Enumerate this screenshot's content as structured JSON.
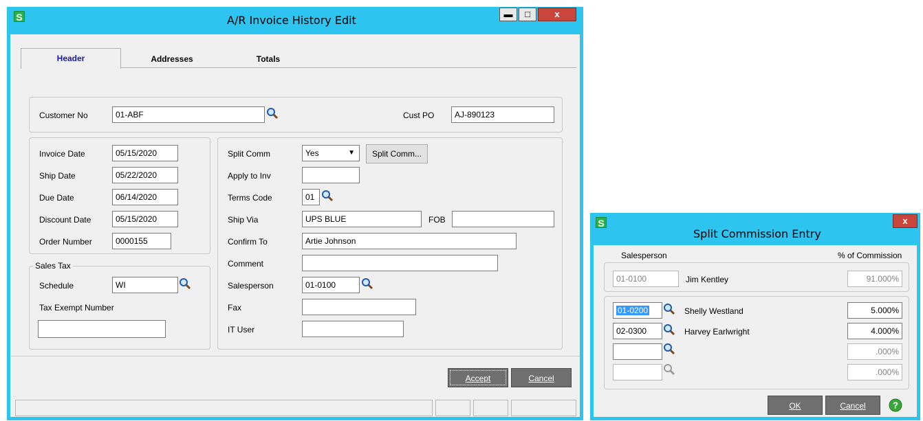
{
  "main_window": {
    "title": "A/R Invoice History Edit",
    "app_icon": "S",
    "controls": {
      "minimize": "minimize-icon",
      "maximize": "maximize-icon",
      "close": "close-icon"
    },
    "tabs": [
      {
        "label": "Header",
        "active": true
      },
      {
        "label": "Addresses",
        "active": false
      },
      {
        "label": "Totals",
        "active": false
      }
    ],
    "customer_no_label": "Customer No",
    "customer_no_value": "01-ABF",
    "cust_po_label": "Cust PO",
    "cust_po_value": "AJ-890123",
    "invoice_date_label": "Invoice Date",
    "invoice_date_value": "05/15/2020",
    "ship_date_label": "Ship Date",
    "ship_date_value": "05/22/2020",
    "due_date_label": "Due Date",
    "due_date_value": "06/14/2020",
    "discount_date_label": "Discount Date",
    "discount_date_value": "05/15/2020",
    "order_number_label": "Order Number",
    "order_number_value": "0000155",
    "sales_tax_group_label": "Sales Tax",
    "schedule_label": "Schedule",
    "schedule_value": "WI",
    "tax_exempt_label": "Tax Exempt Number",
    "tax_exempt_value": "",
    "split_comm_label": "Split Comm",
    "split_comm_value": "Yes",
    "split_comm_button": "Split Comm...",
    "apply_to_inv_label": "Apply to Inv",
    "apply_to_inv_value": "",
    "terms_code_label": "Terms Code",
    "terms_code_value": "01",
    "ship_via_label": "Ship Via",
    "ship_via_value": "UPS BLUE",
    "fob_label": "FOB",
    "fob_value": "",
    "confirm_to_label": "Confirm To",
    "confirm_to_value": "Artie Johnson",
    "comment_label": "Comment",
    "comment_value": "",
    "salesperson_label": "Salesperson",
    "salesperson_value": "01-0100",
    "fax_label": "Fax",
    "fax_value": "",
    "it_user_label": "IT User",
    "it_user_value": "",
    "accept_label": "Accept",
    "cancel_label": "Cancel"
  },
  "split_window": {
    "title": "Split Commission Entry",
    "app_icon": "S",
    "close": "close-icon",
    "col_salesperson": "Salesperson",
    "col_commission": "% of Commission",
    "primary": {
      "code": "01-0100",
      "name": "Jim Kentley",
      "pct": "91.000%"
    },
    "rows": [
      {
        "code": "01-0200",
        "name": "Shelly Westland",
        "pct": "5.000%"
      },
      {
        "code": "02-0300",
        "name": "Harvey Earlwright",
        "pct": "4.000%"
      },
      {
        "code": "",
        "name": "",
        "pct": ".000%"
      },
      {
        "code": "",
        "name": "",
        "pct": ".000%"
      }
    ],
    "ok_label": "OK",
    "cancel_label": "Cancel",
    "help": "help-icon"
  }
}
